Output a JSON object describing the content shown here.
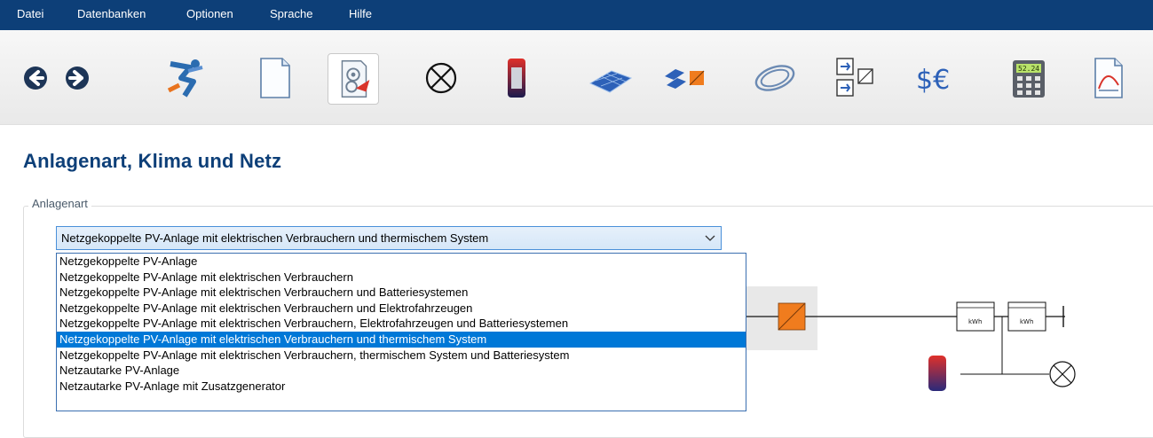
{
  "menu": {
    "items": [
      "Datei",
      "Datenbanken",
      "Optionen",
      "Sprache",
      "Hilfe"
    ]
  },
  "toolbar": {
    "icons": [
      {
        "name": "back-icon"
      },
      {
        "name": "forward-icon"
      },
      {
        "name": "project-runner-icon"
      },
      {
        "name": "document-icon"
      },
      {
        "name": "system-type-icon",
        "active": true
      },
      {
        "name": "consumer-lamp-icon"
      },
      {
        "name": "storage-tank-icon"
      },
      {
        "name": "pv-module-icon"
      },
      {
        "name": "inverter-icon"
      },
      {
        "name": "cable-icon"
      },
      {
        "name": "configuration-icon"
      },
      {
        "name": "currency-icon"
      },
      {
        "name": "calculator-icon"
      },
      {
        "name": "chart-document-icon"
      }
    ],
    "calculator_display": "52.24"
  },
  "page": {
    "title": "Anlagenart, Klima und Netz"
  },
  "anlagenart": {
    "legend": "Anlagenart",
    "selected": "Netzgekoppelte PV-Anlage mit elektrischen Verbrauchern und thermischem System",
    "options": [
      "Netzgekoppelte PV-Anlage",
      "Netzgekoppelte PV-Anlage mit elektrischen Verbrauchern",
      "Netzgekoppelte PV-Anlage mit elektrischen Verbrauchern und Batteriesystemen",
      "Netzgekoppelte PV-Anlage mit elektrischen Verbrauchern und Elektrofahrzeugen",
      "Netzgekoppelte PV-Anlage mit elektrischen Verbrauchern, Elektrofahrzeugen und Batteriesystemen",
      "Netzgekoppelte PV-Anlage mit elektrischen Verbrauchern und thermischem System",
      "Netzgekoppelte PV-Anlage mit elektrischen Verbrauchern, thermischem System und Batteriesystem",
      "Netzautarke PV-Anlage",
      "Netzautarke PV-Anlage mit Zusatzgenerator"
    ],
    "selected_index": 5
  },
  "diagram": {
    "meter_label_1": "kWh",
    "meter_label_2": "kWh"
  },
  "colors": {
    "menubar": "#0d3f78",
    "title": "#0d3f78",
    "selection": "#0078d7",
    "inverter": "#f07c1e"
  }
}
